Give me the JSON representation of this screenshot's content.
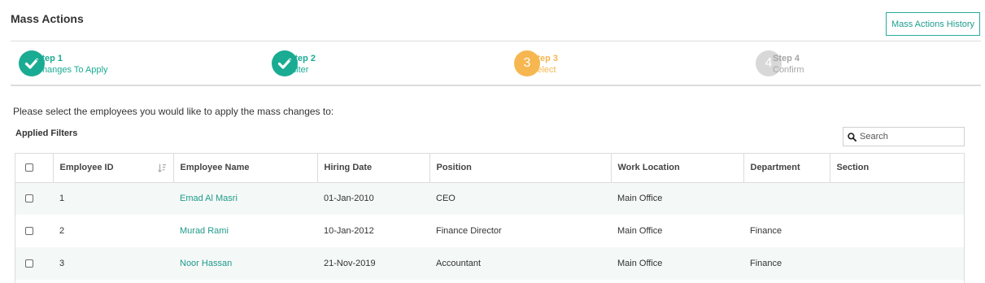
{
  "page": {
    "title": "Mass Actions",
    "history_button": "Mass Actions History"
  },
  "steps": [
    {
      "number": "Step 1",
      "label": "Changes To Apply",
      "state": "done",
      "icon": "check-icon"
    },
    {
      "number": "Step 2",
      "label": "Filter",
      "state": "done",
      "icon": "check-icon"
    },
    {
      "number": "Step 3",
      "label": "Select",
      "state": "current",
      "circle_text": "3"
    },
    {
      "number": "Step 4",
      "label": "Confirm",
      "state": "pending",
      "circle_text": "4"
    }
  ],
  "instruction": "Please select the employees you would like to apply the mass changes to:",
  "applied_filters_label": "Applied Filters",
  "search": {
    "placeholder": "Search",
    "value": ""
  },
  "table": {
    "columns": [
      "Employee ID",
      "Employee Name",
      "Hiring Date",
      "Position",
      "Work Location",
      "Department",
      "Section"
    ],
    "rows": [
      {
        "id": "1",
        "name": "Emad Al Masri",
        "hiring_date": "01-Jan-2010",
        "position": "CEO",
        "work_location": "Main Office",
        "department": "",
        "section": ""
      },
      {
        "id": "2",
        "name": "Murad Rami",
        "hiring_date": "10-Jan-2012",
        "position": "Finance Director",
        "work_location": "Main Office",
        "department": "Finance",
        "section": ""
      },
      {
        "id": "3",
        "name": "Noor Hassan",
        "hiring_date": "21-Nov-2019",
        "position": "Accountant",
        "work_location": "Main Office",
        "department": "Finance",
        "section": ""
      }
    ]
  },
  "colors": {
    "accent_teal": "#1aab93",
    "current_orange": "#f6b650",
    "pending_gray": "#d8d8d8",
    "row_stripe": "#f4f8f7"
  }
}
